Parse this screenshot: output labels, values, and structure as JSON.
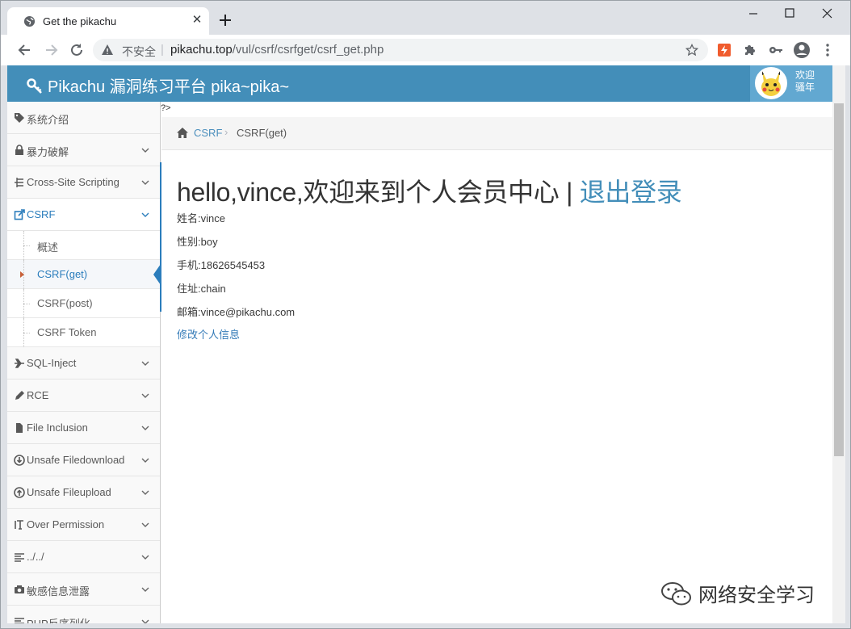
{
  "browser": {
    "tab_title": "Get the pikachu",
    "insecure_label": "不安全",
    "url_host": "pikachu.top",
    "url_path": "/vul/csrf/csrfget/csrf_get.php"
  },
  "site": {
    "brand": "Pikachu 漏洞练习平台 pika~pika~",
    "welcome_line1": "欢迎",
    "welcome_line2": "骚年"
  },
  "sidebar": {
    "items": [
      {
        "label": "系统介绍"
      },
      {
        "label": "暴力破解"
      },
      {
        "label": "Cross-Site Scripting"
      },
      {
        "label": "CSRF"
      },
      {
        "label": "SQL-Inject"
      },
      {
        "label": "RCE"
      },
      {
        "label": "File Inclusion"
      },
      {
        "label": "Unsafe Filedownload"
      },
      {
        "label": "Unsafe Fileupload"
      },
      {
        "label": "Over Permission"
      },
      {
        "label": "../../"
      },
      {
        "label": "敏感信息泄露"
      },
      {
        "label": "PHP反序列化"
      }
    ],
    "csrf_sub": [
      {
        "label": "概述"
      },
      {
        "label": "CSRF(get)"
      },
      {
        "label": "CSRF(post)"
      },
      {
        "label": "CSRF Token"
      }
    ]
  },
  "content": {
    "stray_text": "?>",
    "breadcrumb_link": "CSRF",
    "breadcrumb_current": "CSRF(get)",
    "headline": "hello,vince,欢迎来到个人会员中心 | ",
    "logout": "退出登录",
    "name": "姓名:vince",
    "gender": "性别:boy",
    "phone": "手机:18626545453",
    "address": "住址:chain",
    "email": "邮箱:vince@pikachu.com",
    "edit_link": "修改个人信息"
  },
  "watermark": "网络安全学习",
  "colors": {
    "header_blue": "#438eb9",
    "link_blue": "#2b7dbc"
  }
}
